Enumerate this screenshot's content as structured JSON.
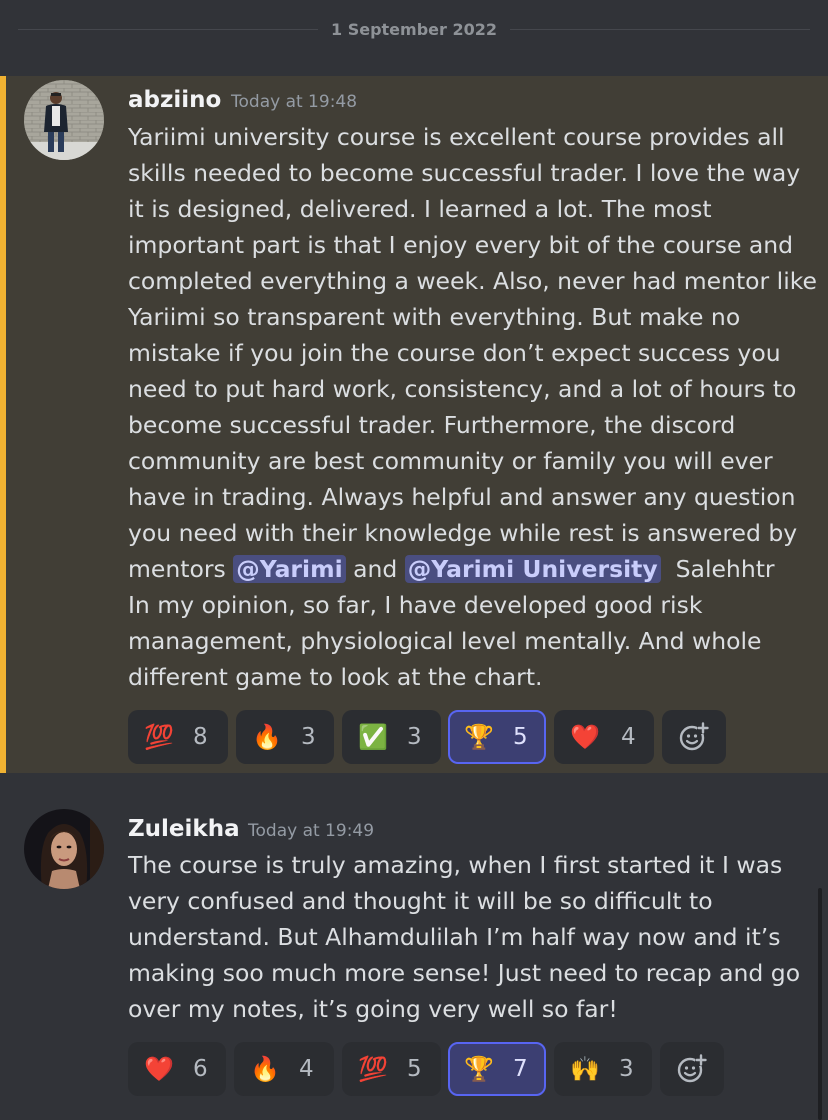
{
  "date_divider": "1 September 2022",
  "messages": [
    {
      "username": "abziino",
      "timestamp": "Today at 19:48",
      "lines": [
        "Yariimi university course is excellent course provides all",
        "skills needed to become successful trader. I love the way",
        "it is designed, delivered. I learned a lot. The most",
        "important part is that I enjoy every bit of the course and",
        "completed everything  a week. Also, never had mentor like",
        "Yariimi so transparent with everything. But make no",
        "mistake if you join the course don’t expect success you",
        "need to put hard work, consistency, and a lot of hours to",
        "become successful trader. Furthermore, the discord",
        "community are best community or family you will ever",
        "have in trading. Always helpful and answer any question",
        "you need with their knowledge while rest is answered by"
      ],
      "mention_line": {
        "prefix": "mentors ",
        "mention1": "@Yarimi",
        "middle": " and ",
        "mention2": "@Yarimi University",
        "suffix": "  Salehhtr"
      },
      "lines_after": [
        "In my opinion, so far, I have developed good risk",
        "management, physiological level mentally. And whole",
        "different game to look at the chart."
      ],
      "reactions": [
        {
          "emoji": "💯",
          "count": "8",
          "active": false
        },
        {
          "emoji": "🔥",
          "count": "3",
          "active": false
        },
        {
          "emoji": "✅",
          "count": "3",
          "active": false
        },
        {
          "emoji": "🏆",
          "count": "5",
          "active": true
        },
        {
          "emoji": "❤️",
          "count": "4",
          "active": false
        }
      ]
    },
    {
      "username": "Zuleikha",
      "timestamp": "Today at 19:49",
      "lines": [
        "The course is truly amazing, when I first started it I was",
        "very confused and thought it will be so difficult to",
        "understand. But Alhamdulilah I’m half way now and it’s",
        "making soo much more sense! Just need to recap and go",
        "over my notes, it’s going very well so far!"
      ],
      "reactions": [
        {
          "emoji": "❤️",
          "count": "6",
          "active": false
        },
        {
          "emoji": "🔥",
          "count": "4",
          "active": false
        },
        {
          "emoji": "💯",
          "count": "5",
          "active": false
        },
        {
          "emoji": "🏆",
          "count": "7",
          "active": true
        },
        {
          "emoji": "🙌",
          "count": "3",
          "active": false
        }
      ]
    }
  ],
  "icons": {
    "add_reaction": "add-reaction-smiley-icon"
  },
  "colors": {
    "background": "#313338",
    "highlight": "#413e36",
    "mention_bar": "#f0b232",
    "mention_bg": "#4a4e80",
    "active_reaction_border": "#5865f2"
  }
}
